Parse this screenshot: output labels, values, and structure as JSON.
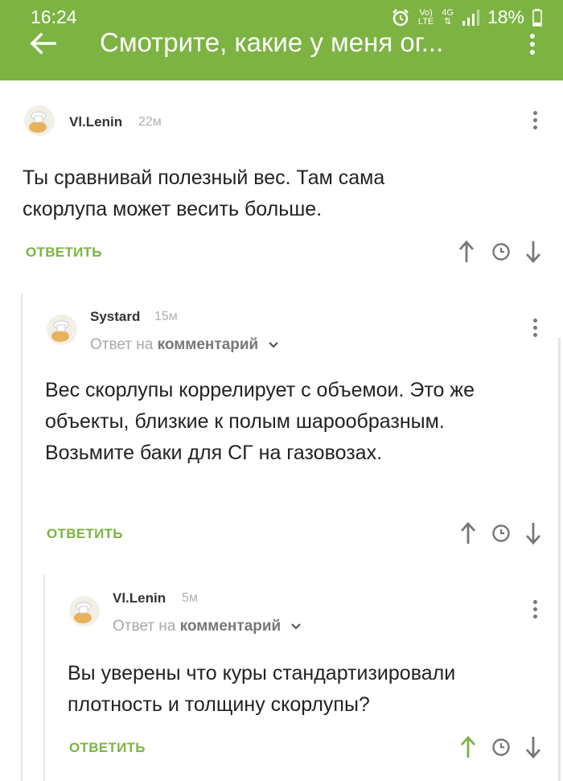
{
  "status_bar": {
    "time": "16:24",
    "network_top": "Vo)",
    "network_bottom": "LTE",
    "signal_type": "4G",
    "battery": "18%"
  },
  "app_bar": {
    "title": "Смотрите, какие у меня ог...",
    "color": "#7cb342"
  },
  "comments": [
    {
      "author": "Vl.Lenin",
      "time": "22м",
      "text": "Ты сравнивай полезный вес. Там сама скорлупа может весить больше.",
      "reply_label": "ОТВЕТИТЬ",
      "upvoted": false
    },
    {
      "author": "Systard",
      "time": "15м",
      "reply_prefix": "Ответ на",
      "reply_target": "комментарий",
      "text": "Вес скорлупы коррелирует с объемои. Это же объекты, близкие к полым шарообразным. Возьмите баки для СГ на газовозах.",
      "reply_label": "ОТВЕТИТЬ",
      "upvoted": false
    },
    {
      "author": "Vl.Lenin",
      "time": "5м",
      "reply_prefix": "Ответ на",
      "reply_target": "комментарий",
      "text": "Вы уверены что куры стандартизировали плотность и толщину скорлупы?",
      "reply_label": "ОТВЕТИТЬ",
      "upvoted": true
    }
  ],
  "icons": {
    "back": "arrow-left-icon",
    "menu": "more-vertical-icon",
    "avatar": "default-avatar-icon",
    "upvote": "arrow-up-icon",
    "downvote": "arrow-down-icon",
    "time": "clock-icon"
  }
}
